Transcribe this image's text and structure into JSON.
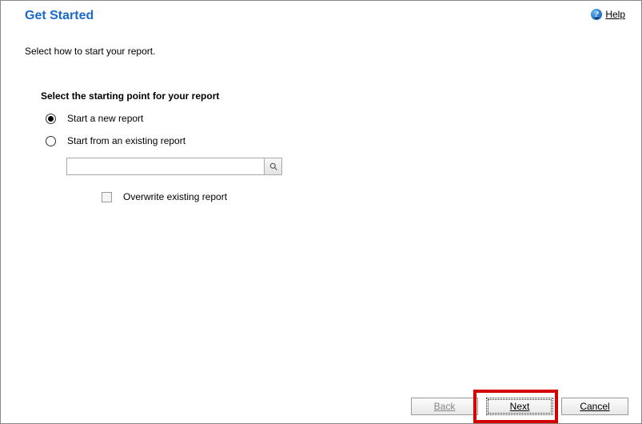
{
  "header": {
    "title": "Get Started",
    "help_label": "Help"
  },
  "subtitle": "Select how to start your report.",
  "section": {
    "heading": "Select the starting point for your report",
    "option_new": "Start a new report",
    "option_existing": "Start from an existing report",
    "search_placeholder": "",
    "overwrite_label": "Overwrite existing report"
  },
  "footer": {
    "back": "Back",
    "next": "Next",
    "cancel": "Cancel"
  }
}
